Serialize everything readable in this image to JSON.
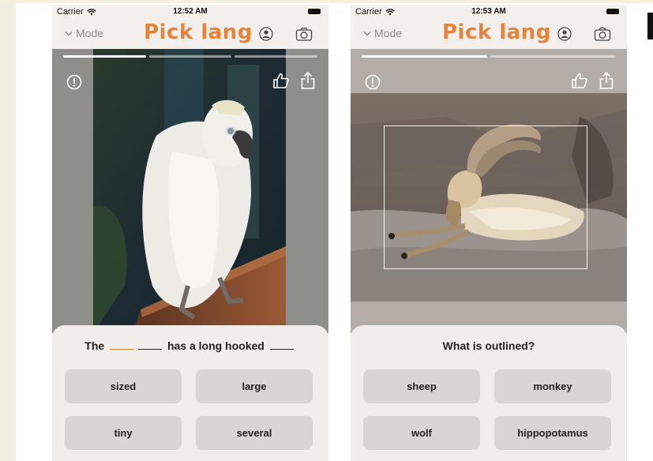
{
  "screens": [
    {
      "status": {
        "carrier": "Carrier",
        "time": "12:52 AM"
      },
      "nav": {
        "mode_label": "Mode",
        "logo": "Pick lang"
      },
      "progress": [
        true,
        false,
        false
      ],
      "prompt": {
        "before": "The",
        "middle": "has a long hooked",
        "after": ""
      },
      "options": [
        "sized",
        "large",
        "tiny",
        "several"
      ]
    },
    {
      "status": {
        "carrier": "Carrier",
        "time": "12:53 AM"
      },
      "nav": {
        "mode_label": "Mode",
        "logo": "Pick lang"
      },
      "progress": [
        true,
        false
      ],
      "prompt": {
        "question": "What is outlined?"
      },
      "options": [
        "sheep",
        "monkey",
        "wolf",
        "hippopotamus"
      ]
    }
  ],
  "colors": {
    "brand": "#e8833a",
    "sheet": "#f0edeb",
    "option_bg": "#d9d5d3"
  },
  "icons": [
    "chevron-down-icon",
    "profile-icon",
    "camera-icon",
    "info-icon",
    "thumbs-up-icon",
    "share-icon",
    "wifi-icon",
    "battery-icon"
  ]
}
